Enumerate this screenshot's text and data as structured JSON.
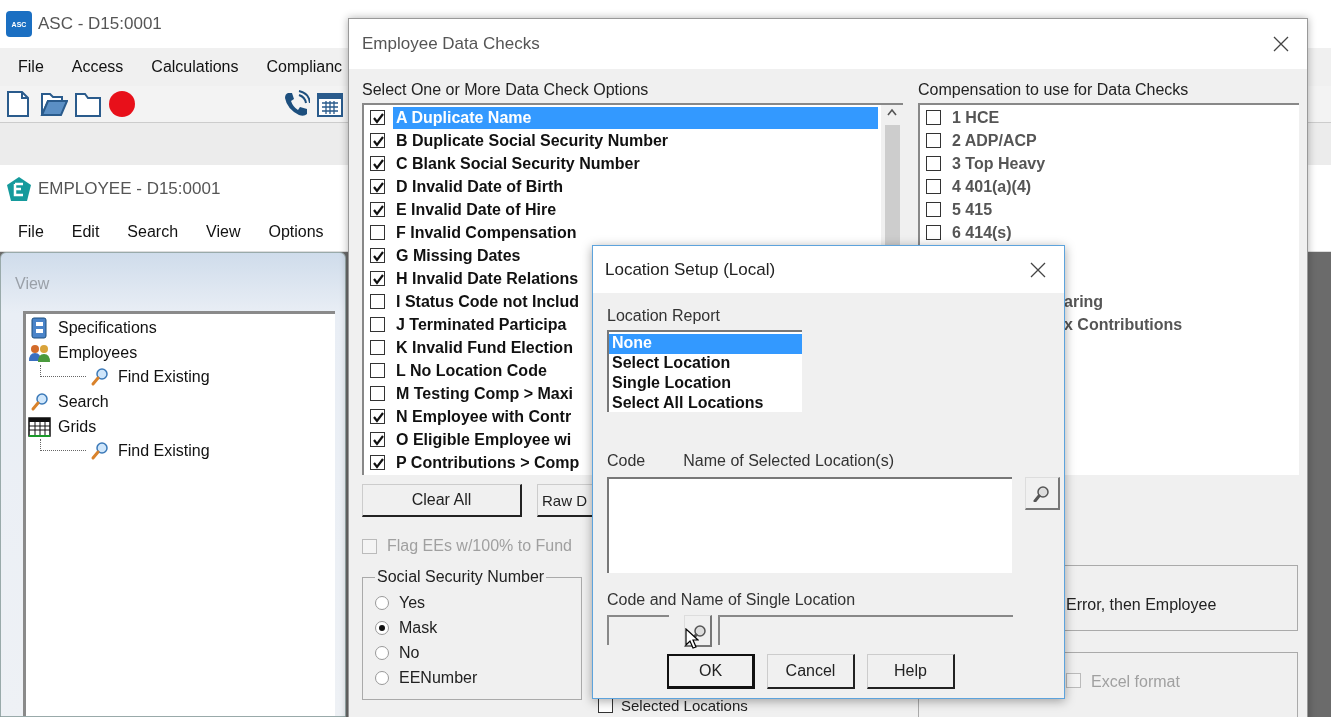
{
  "asc_window": {
    "logo_text": "ASC",
    "title": "ASC - D15:0001",
    "menu": [
      "File",
      "Access",
      "Calculations",
      "Complianc"
    ],
    "toolbar": [
      {
        "kind": "new"
      },
      {
        "kind": "open"
      },
      {
        "kind": "folder"
      },
      {
        "kind": "record"
      },
      {
        "kind": "phone"
      },
      {
        "kind": "calendar"
      }
    ]
  },
  "employee_window": {
    "title": "EMPLOYEE - D15:0001",
    "menu": [
      "File",
      "Edit",
      "Search",
      "View",
      "Options"
    ],
    "panel_title": "View",
    "tree": [
      {
        "label": "Specifications",
        "kind": "book"
      },
      {
        "label": "Employees",
        "kind": "people",
        "children": [
          {
            "label": "Find Existing",
            "kind": "search"
          }
        ]
      },
      {
        "label": "Search",
        "kind": "search"
      },
      {
        "label": "Grids",
        "kind": "grid",
        "children": [
          {
            "label": "Find Existing",
            "kind": "search"
          }
        ]
      }
    ]
  },
  "checks_dialog": {
    "title": "Employee Data Checks",
    "options_label": "Select One or More Data Check Options",
    "options": [
      {
        "label": "A Duplicate Name",
        "checked": true,
        "selected": true
      },
      {
        "label": "B Duplicate Social Security Number",
        "checked": true,
        "selected": false
      },
      {
        "label": "C Blank Social Security Number",
        "checked": true,
        "selected": false
      },
      {
        "label": "D Invalid Date of Birth",
        "checked": true,
        "selected": false
      },
      {
        "label": "E Invalid Date of Hire",
        "checked": true,
        "selected": false
      },
      {
        "label": "F Invalid Compensation",
        "checked": false,
        "selected": false
      },
      {
        "label": "G Missing Dates",
        "checked": true,
        "selected": false
      },
      {
        "label": "H Invalid Date Relations",
        "checked": true,
        "selected": false
      },
      {
        "label": "I Status Code not Includ",
        "checked": false,
        "selected": false
      },
      {
        "label": "J Terminated Participa",
        "checked": false,
        "selected": false
      },
      {
        "label": "K Invalid Fund Election",
        "checked": false,
        "selected": false
      },
      {
        "label": "L No Location Code",
        "checked": false,
        "selected": false
      },
      {
        "label": "M Testing Comp > Maxi",
        "checked": false,
        "selected": false
      },
      {
        "label": "N Employee with Contr",
        "checked": true,
        "selected": false
      },
      {
        "label": "O Eligible Employee wi",
        "checked": true,
        "selected": false
      },
      {
        "label": "P Contributions > Comp",
        "checked": true,
        "selected": false
      }
    ],
    "compensation_label": "Compensation to use for Data Checks",
    "compensation": [
      {
        "label": "1 HCE",
        "checked": false,
        "kind": "full"
      },
      {
        "label": "2 ADP/ACP",
        "checked": false,
        "kind": "full"
      },
      {
        "label": "3 Top Heavy",
        "checked": false,
        "kind": "full"
      },
      {
        "label": "4 401(a)(4)",
        "checked": false,
        "kind": "full"
      },
      {
        "label": "5 415",
        "checked": false,
        "kind": "full"
      },
      {
        "label": "6 414(s)",
        "checked": false,
        "kind": "full"
      },
      {
        "label": "aring",
        "kind": "cut"
      },
      {
        "label": "x Contributions",
        "kind": "cut"
      }
    ],
    "buttons": [
      "Clear All",
      "Raw D"
    ],
    "flag": {
      "label": "Flag EEs w/100% to Fund",
      "checked": false,
      "disabled": true
    },
    "ssn_group": {
      "label": "Social Security Number",
      "options": [
        {
          "label": "Yes",
          "selected": false
        },
        {
          "label": "Mask",
          "selected": true
        },
        {
          "label": "No",
          "selected": false
        },
        {
          "label": "EENumber",
          "selected": false
        }
      ]
    },
    "selected_locations": {
      "label": "Selected Locations",
      "checked": false
    },
    "sort_text": "Error, then Employee",
    "excel": {
      "label": "Excel format",
      "checked": false,
      "disabled": true
    }
  },
  "location_dialog": {
    "title": "Location Setup (Local)",
    "report_label": "Location Report",
    "report_options": [
      {
        "label": "None",
        "selected": true
      },
      {
        "label": "Select Location",
        "selected": false
      },
      {
        "label": "Single Location",
        "selected": false
      },
      {
        "label": "Select All Locations",
        "selected": false
      }
    ],
    "code_label": "Code",
    "name_label": "Name of Selected Location(s)",
    "single_label": "Code and Name of Single Location",
    "buttons": [
      {
        "label": "OK",
        "default": true
      },
      {
        "label": "Cancel",
        "default": false
      },
      {
        "label": "Help",
        "default": false
      }
    ]
  }
}
